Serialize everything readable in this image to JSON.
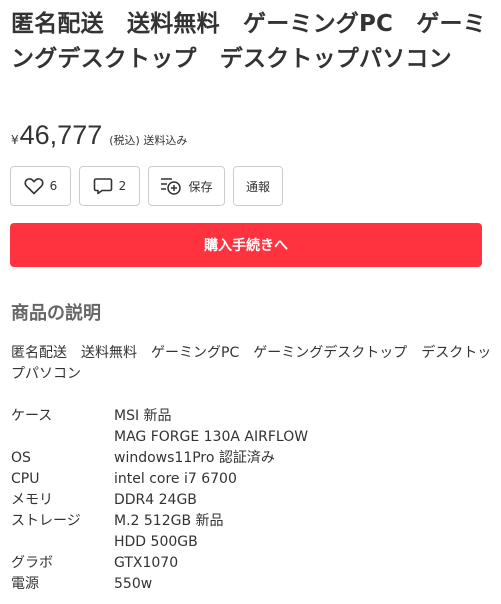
{
  "product": {
    "title": "匿名配送　送料無料　ゲーミングPC　ゲーミングデスクトップ　デスクトップパソコン",
    "price_symbol": "¥",
    "price": "46,777",
    "price_note": "(税込) 送料込み"
  },
  "actions": {
    "like_count": "6",
    "comment_count": "2",
    "save_label": "保存",
    "report_label": "通報"
  },
  "purchase": {
    "button_label": "購入手続きへ"
  },
  "description": {
    "heading": "商品の説明",
    "text": "匿名配送　送料無料　ゲーミングPC　ゲーミングデスクトップ　デスクトップパソコン",
    "specs": [
      {
        "label": "ケース",
        "value": "MSI  新品"
      },
      {
        "label": "",
        "value": "MAG FORGE 130A AIRFLOW"
      },
      {
        "label": "OS",
        "value": "windows11Pro 認証済み"
      },
      {
        "label": "CPU",
        "value": "intel core i7 6700"
      },
      {
        "label": "メモリ",
        "value": "DDR4  24GB"
      },
      {
        "label": "ストレージ",
        "value": "M.2 512GB  新品"
      },
      {
        "label": "",
        "value": "HDD 500GB"
      },
      {
        "label": "グラボ",
        "value": "GTX1070"
      },
      {
        "label": "電源",
        "value": "550w"
      }
    ]
  },
  "colors": {
    "buy_button": "#ff333f",
    "border": "#cccccc",
    "text": "#333333"
  },
  "icons": [
    "heart-icon",
    "comment-icon",
    "save-icon",
    "report"
  ]
}
